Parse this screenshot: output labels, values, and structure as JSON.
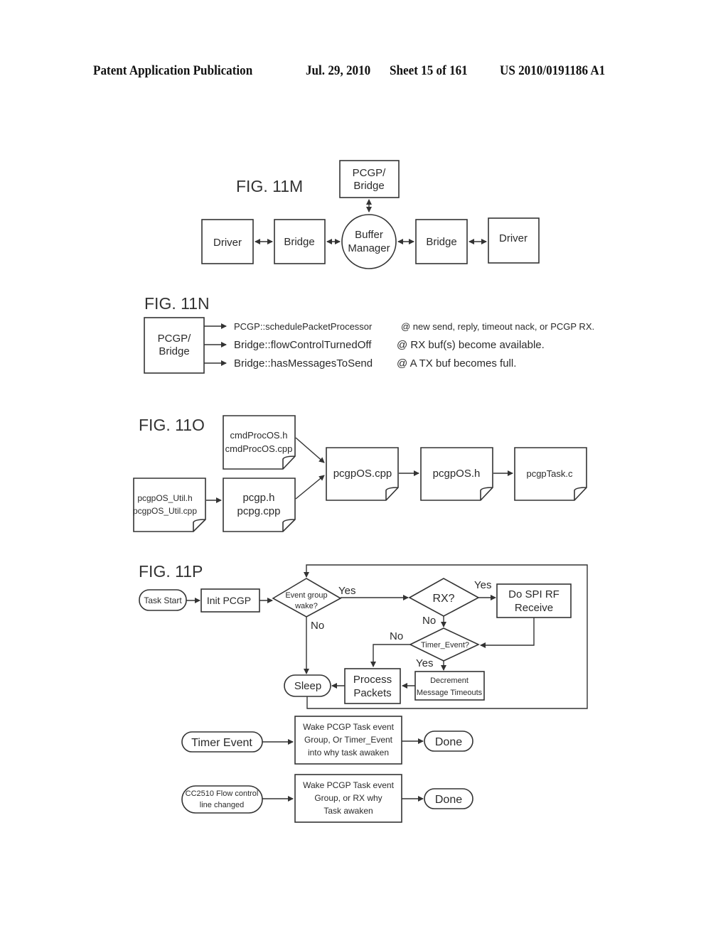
{
  "header": {
    "publication": "Patent Application Publication",
    "date": "Jul. 29, 2010",
    "sheet": "Sheet 15 of 161",
    "number": "US 2010/0191186 A1"
  },
  "fig11m": {
    "title": "FIG. 11M",
    "top": [
      "PCGP/",
      "Bridge"
    ],
    "driver_left": "Driver",
    "bridge_left": "Bridge",
    "buffer": [
      "Buffer",
      "Manager"
    ],
    "bridge_right": "Bridge",
    "driver_right": "Driver"
  },
  "fig11n": {
    "title": "FIG. 11N",
    "source": [
      "PCGP/",
      "Bridge"
    ],
    "calls": [
      {
        "method": "PCGP::schedulePacketProcessor",
        "when": "@ new send, reply, timeout nack, or PCGP RX."
      },
      {
        "method": "Bridge::flowControlTurnedOff",
        "when": "@ RX buf(s) become available."
      },
      {
        "method": "Bridge::hasMessagesToSend",
        "when": "@ A TX buf becomes full."
      }
    ]
  },
  "fig11o": {
    "title": "FIG. 11O",
    "files": {
      "cmdproc": [
        "cmdProcOS.h",
        "cmdProcOS.cpp"
      ],
      "util": [
        "pcgpOS_Util.h",
        "pcgpOS_Util.cpp"
      ],
      "pcgp": [
        "pcgp.h",
        "pcpg.cpp"
      ],
      "pcgpos_cpp": "pcgpOS.cpp",
      "pcgpos_h": "pcgpOS.h",
      "pcgptask": "pcgpTask.c"
    }
  },
  "fig11p": {
    "title": "FIG. 11P",
    "task_start": "Task Start",
    "init": "Init PCGP",
    "event_wake": [
      "Event group",
      "wake?"
    ],
    "yes1": "Yes",
    "no1": "No",
    "rx": "RX?",
    "yes2": "Yes",
    "no2": "No",
    "spi": [
      "Do SPI RF",
      "Receive"
    ],
    "timer_q": "Timer_Event?",
    "no3": "No",
    "yes3": "Yes",
    "process": [
      "Process",
      "Packets"
    ],
    "decrement": [
      "Decrement",
      "Message Timeouts"
    ],
    "sleep": "Sleep",
    "timer_event": "Timer Event",
    "wake1": [
      "Wake PCGP Task event",
      "Group, Or Timer_Event",
      "into why task awaken"
    ],
    "done1": "Done",
    "cc2510": [
      "CC2510 Flow control",
      "line changed"
    ],
    "wake2": [
      "Wake PCGP Task event",
      "Group, or RX why",
      "Task awaken"
    ],
    "done2": "Done"
  }
}
